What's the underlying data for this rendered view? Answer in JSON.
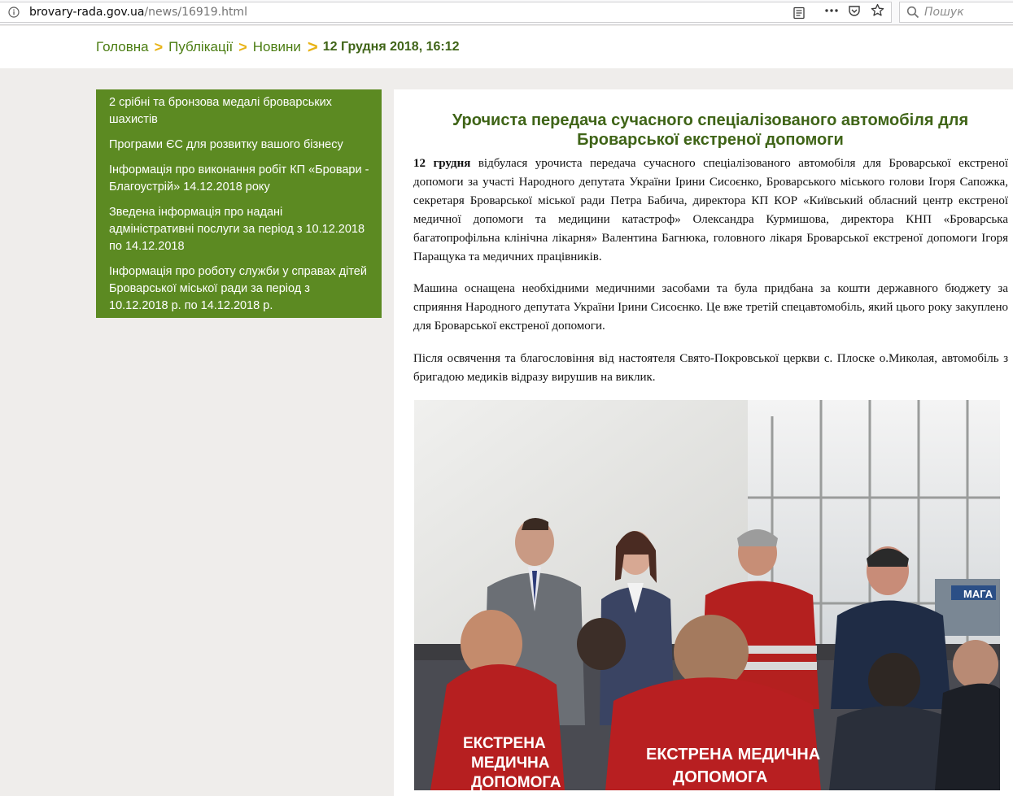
{
  "browser": {
    "url_domain": "brovary-rada.gov.ua",
    "url_path": "/news/16919.html",
    "search_placeholder": "Пошук"
  },
  "breadcrumb": {
    "home": "Головна",
    "publications": "Публікації",
    "news": "Новини",
    "current": "12 Грудня 2018, 16:12",
    "separator": ">"
  },
  "sidebar": {
    "items": [
      {
        "label": "2 срібні та бронзова медалі броварських шахистів"
      },
      {
        "label": "Програми ЄС для розвитку вашого бізнесу"
      },
      {
        "label": "Інформація про виконання робіт КП «Бровари - Благоустрій» 14.12.2018 року"
      },
      {
        "label": "Зведена інформація про надані адміністративні послуги за період з 10.12.2018 по 14.12.2018"
      },
      {
        "label": "Інформація про роботу служби у справах дітей Броварської міської ради за період з 10.12.2018 р. по 14.12.2018 р."
      }
    ]
  },
  "article": {
    "title": "Урочиста передача сучасного спеціалізованого автомобіля для Броварської екстреної допомоги",
    "p1_date": "12 грудня",
    "p1_text": " відбулася урочиста передача сучасного спеціалізованого автомобіля для Броварської екстреної допомоги за участі Народного депутата України Ірини Сисоєнко, Броварського міського голови Ігоря Сапожка, секретаря Броварської міської ради Петра Бабича, директора КП КОР «Київський обласний центр екстреної медичної допомоги та медицини катастроф» Олександра Курмишова,  директора КНП «Броварська багатопрофільна клінічна лікарня» Валентина Багнюка, головного лікаря Броварської екстреної допомоги Ігоря Паращука та медичних працівників.",
    "p2": "Машина оснащена необхідними медичними засобами та була придбана за кошти державного бюджету за сприяння Народного депутата України Ірини Сисоєнко. Це вже третій спецавтомобіль, який цього року закуплено для Броварської екстреної допомоги.",
    "p3": "Після освячення та благословіння від настоятеля Свято-Покровської церкви с. Плоске    о.Миколая, автомобіль з бригадою медиків відразу вирушив на виклик.",
    "photo": {
      "jacket_text_left_1": "ЕКСТРЕНА",
      "jacket_text_left_2": "МЕДИЧНА",
      "jacket_text_left_3": "ДОПОМОГА",
      "jacket_text_right_1": "ЕКСТРЕНА МЕДИЧНА",
      "jacket_text_right_2": "ДОПОМОГА",
      "window_sign": "МАГА"
    }
  },
  "colors": {
    "accent_green": "#5c8a22",
    "title_green": "#3f6417",
    "link_green": "#4b7d12",
    "separator_yellow": "#e8b316",
    "page_bg": "#efedeb"
  }
}
